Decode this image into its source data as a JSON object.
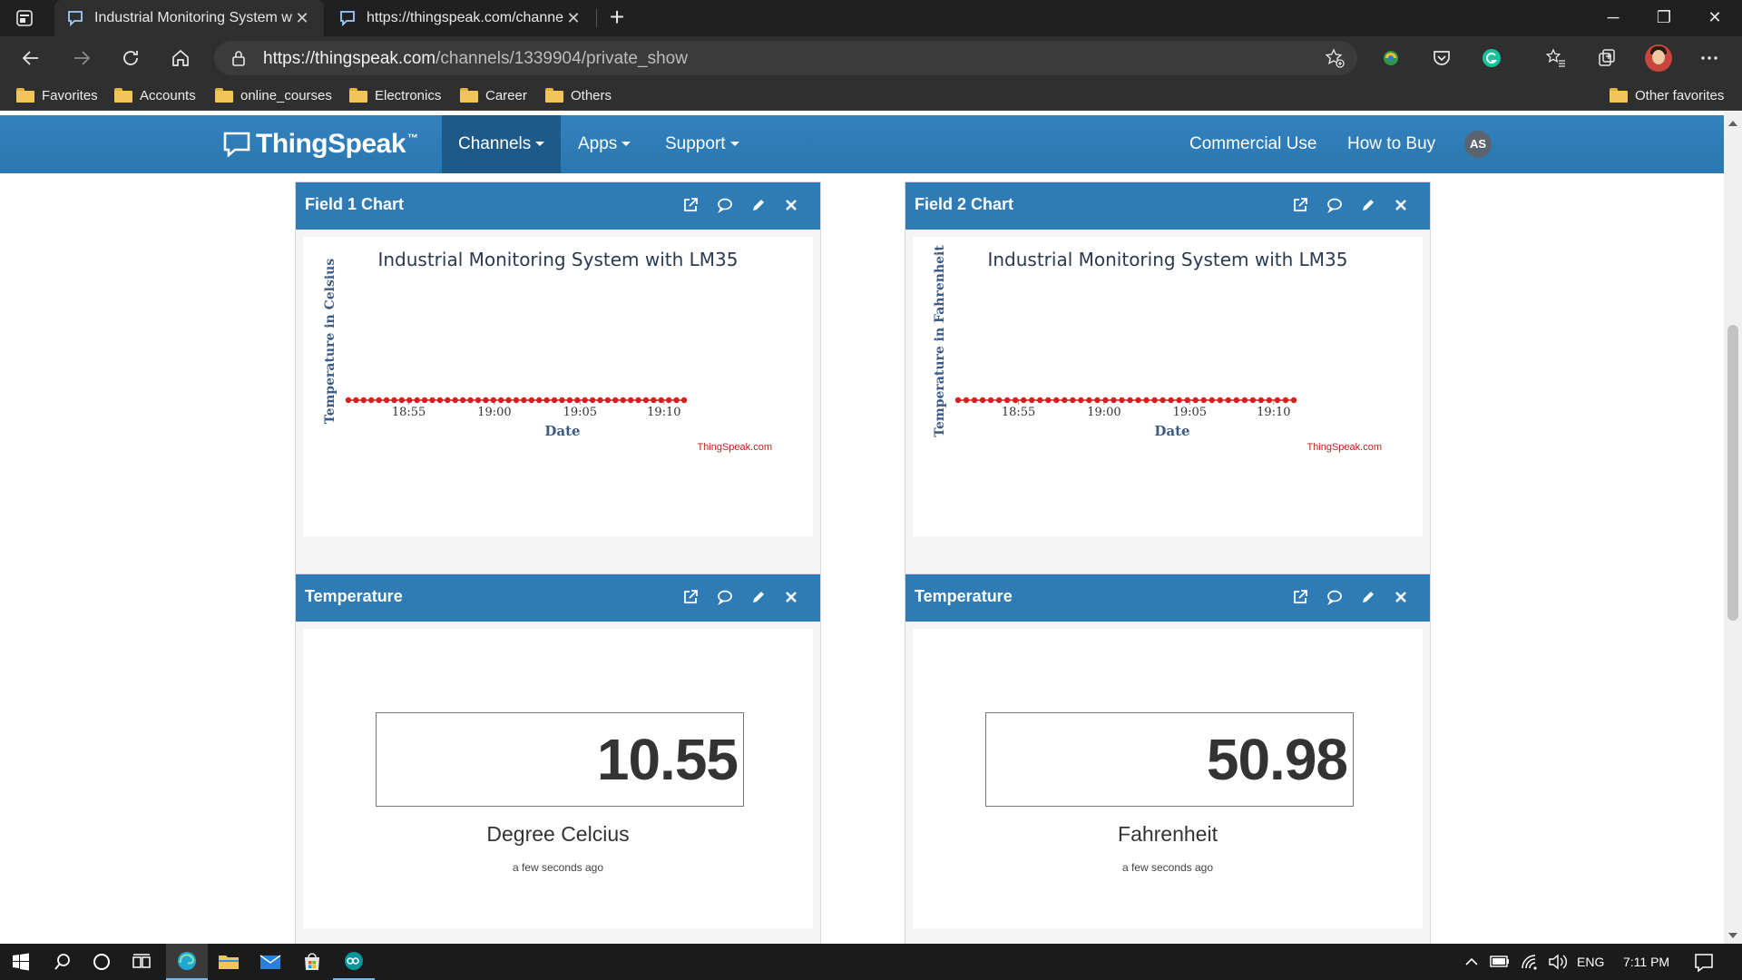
{
  "browser": {
    "tabs": [
      {
        "title": "Industrial Monitoring System wit",
        "active": true
      },
      {
        "title": "https://thingspeak.com/channels",
        "active": false
      }
    ],
    "address": {
      "domain": "https://thingspeak.com",
      "path": "/channels/1339904/private_show"
    },
    "favorites": [
      "Favorites",
      "Accounts",
      "online_courses",
      "Electronics",
      "Career",
      "Others"
    ],
    "other_favorites": "Other favorites",
    "icons": [
      "back-icon",
      "forward-icon",
      "refresh-icon",
      "home-icon",
      "lock-icon",
      "add-favorite-icon",
      "collections-icon",
      "grammarly-icon",
      "favorites-icon",
      "settings-more-icon"
    ]
  },
  "site": {
    "logo": "ThingSpeak",
    "logo_tm": "™",
    "nav": {
      "channels": "Channels",
      "apps": "Apps",
      "support": "Support",
      "commercial": "Commercial Use",
      "buy": "How to Buy",
      "user_initials": "AS"
    },
    "colors": {
      "header": "#2e7bb5",
      "series": "#d62020",
      "accent": "#2c7bb6"
    }
  },
  "widgets": {
    "field1": {
      "title": "Field 1 Chart"
    },
    "field2": {
      "title": "Field 2 Chart"
    },
    "lamp1": {
      "title": "Temperature",
      "value": "10.55",
      "unit": "Degree Celcius",
      "ago": "a few seconds ago"
    },
    "lamp2": {
      "title": "Temperature",
      "value": "50.98",
      "unit": "Fahrenheit",
      "ago": "a few seconds ago"
    }
  },
  "chart_data": [
    {
      "type": "line",
      "title": "Industrial Monitoring System with LM35",
      "xlabel": "Date",
      "ylabel": "Temperature in Celsius",
      "credit": "ThingSpeak.com",
      "x_ticks": [
        "18:55",
        "19:00",
        "19:05",
        "19:10"
      ],
      "series": [
        {
          "values": [
            0,
            0,
            0,
            0,
            0,
            0,
            0,
            0,
            0,
            0,
            0,
            0,
            0,
            0,
            0,
            0,
            0,
            0,
            0,
            0,
            0,
            0,
            0,
            0,
            0,
            0,
            0,
            0,
            0,
            0,
            0,
            0,
            0,
            0,
            0,
            0,
            0,
            0,
            0,
            0,
            0,
            0,
            0,
            0,
            0
          ]
        }
      ]
    },
    {
      "type": "line",
      "title": "Industrial Monitoring System with LM35",
      "xlabel": "Date",
      "ylabel": "Temperature in Fahrenheit",
      "credit": "ThingSpeak.com",
      "x_ticks": [
        "18:55",
        "19:00",
        "19:05",
        "19:10"
      ],
      "series": [
        {
          "values": [
            0,
            0,
            0,
            0,
            0,
            0,
            0,
            0,
            0,
            0,
            0,
            0,
            0,
            0,
            0,
            0,
            0,
            0,
            0,
            0,
            0,
            0,
            0,
            0,
            0,
            0,
            0,
            0,
            0,
            0,
            0,
            0,
            0,
            0,
            0,
            0,
            0,
            0,
            0,
            0,
            0,
            0
          ]
        }
      ]
    }
  ],
  "taskbar": {
    "lang": "ENG",
    "time": "7:11 PM"
  }
}
